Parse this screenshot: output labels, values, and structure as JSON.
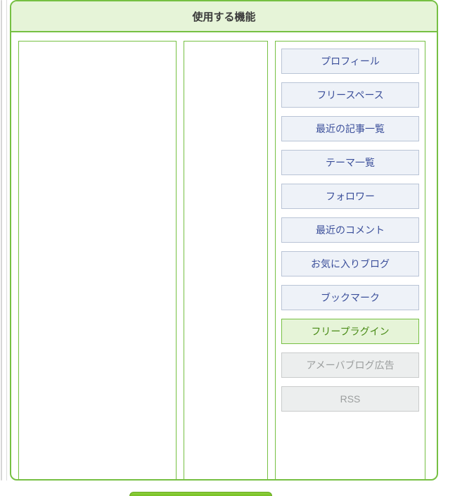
{
  "panel": {
    "title": "使用する機能"
  },
  "modules": [
    {
      "label": "プロフィール",
      "state": "normal"
    },
    {
      "label": "フリースペース",
      "state": "normal"
    },
    {
      "label": "最近の記事一覧",
      "state": "normal"
    },
    {
      "label": "テーマ一覧",
      "state": "normal"
    },
    {
      "label": "フォロワー",
      "state": "normal"
    },
    {
      "label": "最近のコメント",
      "state": "normal"
    },
    {
      "label": "お気に入りブログ",
      "state": "normal"
    },
    {
      "label": "ブックマーク",
      "state": "normal"
    },
    {
      "label": "フリープラグイン",
      "state": "selected"
    },
    {
      "label": "アメーバブログ広告",
      "state": "disabled"
    },
    {
      "label": "RSS",
      "state": "disabled"
    }
  ]
}
